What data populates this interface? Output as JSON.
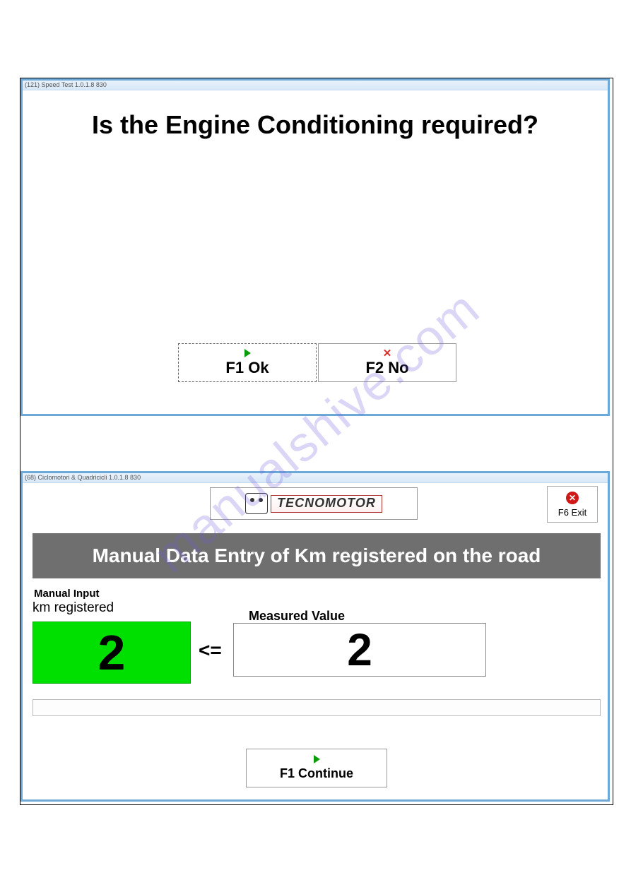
{
  "watermark": "manualshive.com",
  "window1": {
    "title": "(121) Speed Test 1.0.1.8  830",
    "question": "Is the Engine Conditioning required?",
    "buttons": {
      "ok": "F1 Ok",
      "no": "F2 No"
    }
  },
  "window2": {
    "title": "(68) Ciclomotori & Quadricicli 1.0.1.8  830",
    "logo_text": "TECNOMOTOR",
    "exit_label": "F6 Exit",
    "banner": "Manual Data Entry of Km registered on the road",
    "labels": {
      "manual_input": "Manual Input",
      "km_registered": "km registered",
      "measured_value": "Measured Value"
    },
    "km_value": "2",
    "comparison": "<=",
    "measured_value": "2",
    "continue_label": "F1 Continue"
  }
}
